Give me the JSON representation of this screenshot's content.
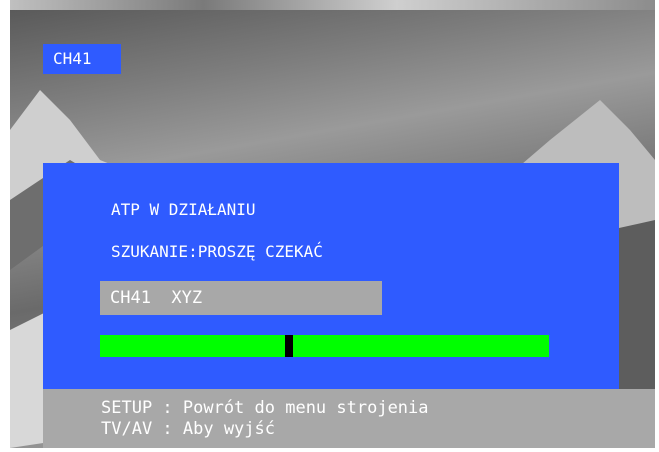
{
  "channel_badge": "CH41",
  "dialog": {
    "status_line": "ATP W DZIAŁANIU",
    "search_line": "SZUKANIE:PROSZĘ CZEKAĆ",
    "current_channel": "CH41  XYZ",
    "progress_fraction": 0.42
  },
  "help": {
    "line1": "SETUP : Powrót do menu strojenia",
    "line2": "TV/AV : Aby wyjść"
  },
  "colors": {
    "osd_blue": "#2f5bff",
    "progress_green": "#00ff00",
    "gray_bar": "#a8a8a8"
  }
}
